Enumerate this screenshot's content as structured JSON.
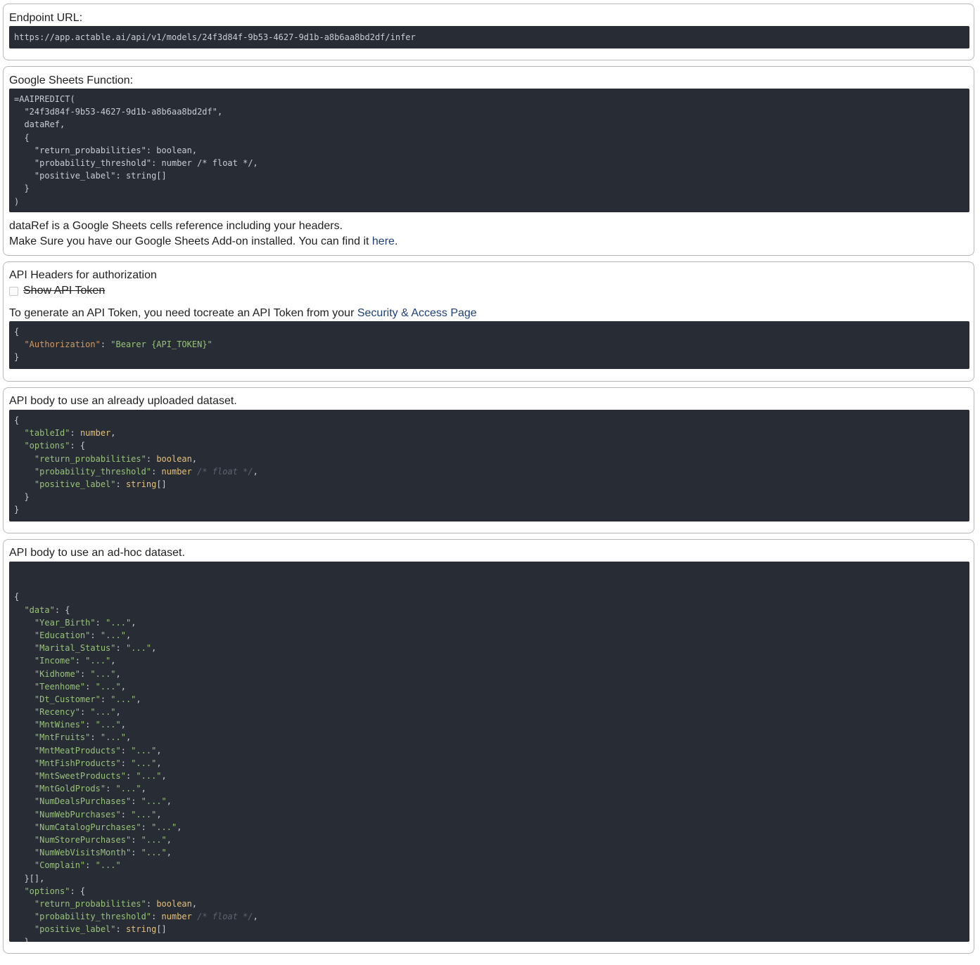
{
  "endpoint": {
    "label": "Endpoint URL:",
    "url": "https://app.actable.ai/api/v1/models/24f3d84f-9b53-4627-9d1b-a8b6aa8bd2df/infer"
  },
  "sheets": {
    "label": "Google Sheets Function:",
    "code_lines": [
      "=AAIPREDICT(",
      "  \"24f3d84f-9b53-4627-9d1b-a8b6aa8bd2df\",",
      "  dataRef,",
      "  {",
      "    \"return_probabilities\": boolean,",
      "    \"probability_threshold\": number /* float */,",
      "    \"positive_label\": string[]",
      "  }",
      ")"
    ],
    "note_line1": "dataRef is a Google Sheets cells reference including your headers.",
    "note_line2_prefix": "Make Sure you have our Google Sheets Add-on installed. You can find it ",
    "note_link": "here",
    "note_line2_suffix": "."
  },
  "headers": {
    "label": "API Headers for authorization",
    "checkbox_label": "Show API Token",
    "checkbox_checked": false,
    "token_text_prefix": "To generate an API Token, you need tocreate an API Token from your ",
    "token_link": "Security & Access Page",
    "code": {
      "open": "{",
      "key": "\"Authorization\"",
      "sep": ": ",
      "value": "\"Bearer {API_TOKEN}\"",
      "close": "}"
    }
  },
  "body_uploaded": {
    "label": "API body to use an already uploaded dataset.",
    "tableId_key": "\"tableId\"",
    "tableId_type": "number",
    "options_key": "\"options\"",
    "return_probabilities_key": "\"return_probabilities\"",
    "probability_threshold_key": "\"probability_threshold\"",
    "positive_label_key": "\"positive_label\"",
    "boolean_type": "boolean",
    "number_type": "number",
    "float_comment": "/* float */",
    "string_array_type": "string",
    "array_suffix": "[]"
  },
  "body_adhoc": {
    "label": "API body to use an ad-hoc dataset.",
    "data_key": "\"data\"",
    "placeholder_value": "\"...\"",
    "fields": [
      "\"Year_Birth\"",
      "\"Education\"",
      "\"Marital_Status\"",
      "\"Income\"",
      "\"Kidhome\"",
      "\"Teenhome\"",
      "\"Dt_Customer\"",
      "\"Recency\"",
      "\"MntWines\"",
      "\"MntFruits\"",
      "\"MntMeatProducts\"",
      "\"MntFishProducts\"",
      "\"MntSweetProducts\"",
      "\"MntGoldProds\"",
      "\"NumDealsPurchases\"",
      "\"NumWebPurchases\"",
      "\"NumCatalogPurchases\"",
      "\"NumStorePurchases\"",
      "\"NumWebVisitsMonth\"",
      "\"Complain\""
    ],
    "data_close": "}[],",
    "options_key": "\"options\"",
    "return_probabilities_key": "\"return_probabilities\"",
    "probability_threshold_key": "\"probability_threshold\"",
    "positive_label_key": "\"positive_label\"",
    "boolean_type": "boolean",
    "number_type": "number",
    "float_comment": "/* float */",
    "string_array_type": "string",
    "array_suffix": "[]"
  }
}
